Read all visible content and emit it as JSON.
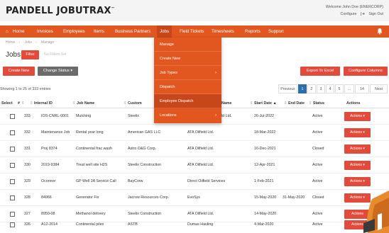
{
  "app": {
    "logo": "PANDELL JOBUTRAX",
    "logo_mark": "™",
    "welcome": "Welcome John Doe (ENERCORP)",
    "configure": "Configure",
    "sign_out": "Sign Out"
  },
  "nav": {
    "items": [
      "Home",
      "Invoices",
      "Employees",
      "Items",
      "Business Partners",
      "Jobs",
      "Field Tickets",
      "Timesheets",
      "Reports",
      "Support"
    ],
    "active": "Jobs"
  },
  "breadcrumb": [
    "Home",
    "Jobs",
    "Manage"
  ],
  "page": {
    "title": "Jobs",
    "filter_label": "Filter",
    "filter_status": "No Filters Set"
  },
  "toolbar": {
    "create_new": "Create New",
    "change_status": "Change Status ▾",
    "export": "Export To Excel",
    "configure_columns": "Configure Columns"
  },
  "table_info": "Showing 1 to 25 of 333 entries",
  "pagination": [
    "Previous",
    "1",
    "2",
    "3",
    "4",
    "5",
    "...",
    "14",
    "Next"
  ],
  "columns": {
    "select": "Select",
    "num": "#",
    "internal_id": "Internal ID",
    "job_name": "Job Name",
    "customer": "Custom",
    "name2": "Name",
    "start_date": "Start Date",
    "end_date": "End Date",
    "status": "Status",
    "actions": "Actions"
  },
  "rows": [
    {
      "num": "333",
      "internal_id": "IOS-CNRL-0001",
      "job_name": "Mulching",
      "customer": "Steelix",
      "name2": "ld Ltd.",
      "start": "26-Jul-2022",
      "end": "",
      "status": "Active",
      "action": "Actions ▾"
    },
    {
      "num": "332",
      "internal_id": "Maintenance Job",
      "job_name": "Rental year long",
      "customer": "American GAS LLC",
      "name2": "ATA Oilfield Ltd.",
      "start": "18-Mar-2022",
      "end": "",
      "status": "Active",
      "action": "Actions ▾"
    },
    {
      "num": "331",
      "internal_id": "Proj 8374",
      "job_name": "Continental frac wash",
      "customer": "Astro O&G Corp.",
      "name2": "ATA Oilfield Ltd.",
      "start": "16-Dec-2021",
      "end": "",
      "status": "Closed",
      "action": "Actions ▾"
    },
    {
      "num": "330",
      "internal_id": "2019-9384",
      "job_name": "Treat well site H2S",
      "customer": "Steelix Construction",
      "name2": "ATA Oilfield Ltd.",
      "start": "12-Apr-2021",
      "end": "",
      "status": "Active",
      "action": "Actions ▾"
    },
    {
      "num": "329",
      "internal_id": "Oconnor",
      "job_name": "GP Well 2A Service Call",
      "customer": "BayCrew",
      "name2": "Direct Oilfield Services",
      "start": "1-Feb-2021",
      "end": "",
      "status": "Active",
      "action": "Actions ▾"
    },
    {
      "num": "328",
      "internal_id": "84966",
      "job_name": "Generator Fix",
      "customer": "Jacrow Resources Corp.",
      "name2": "EvoSys",
      "start": "15-May-2020",
      "end": "31-May-2020",
      "status": "Closed",
      "action": "Actions ▾"
    },
    {
      "num": "327",
      "internal_id": "8950-08",
      "job_name": "Methanol delivery",
      "customer": "Steelix Construction",
      "name2": "ATA Oilfield Ltd.",
      "start": "14-May-2020",
      "end": "",
      "status": "Active",
      "action": "Actions"
    },
    {
      "num": "326",
      "internal_id": "A12-2014",
      "job_name": "Continental piles",
      "customer": "ASTB",
      "name2": "Dumas Hauling",
      "start": "4-Mar-2020",
      "end": "",
      "status": "Active",
      "action": "Actions"
    }
  ],
  "dropdown": {
    "items": [
      "Manage",
      "Create New",
      "Job Types",
      "Dispatch",
      "Employee Dispatch",
      "Locations"
    ],
    "highlighted": "Employee Dispatch",
    "arrow": "›"
  },
  "colors": {
    "nav": "#e2571f",
    "nav_active": "#c7461a",
    "button_red": "#e24a3b",
    "page_active": "#2d6ea8"
  }
}
